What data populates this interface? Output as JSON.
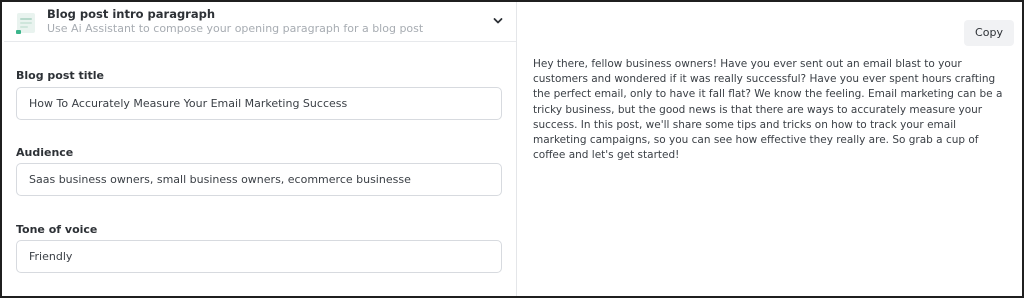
{
  "template": {
    "title": "Blog post intro paragraph",
    "subtitle": "Use Ai Assistant to compose your opening paragraph for a blog post",
    "icon": "document-template-icon",
    "toggle_icon": "chevron-down-icon"
  },
  "form": {
    "blog_title": {
      "label": "Blog post title",
      "value": "How To Accurately Measure Your Email Marketing Success"
    },
    "audience": {
      "label": "Audience",
      "value": "Saas business owners, small business owners, ecommerce businesse"
    },
    "tone": {
      "label": "Tone of voice",
      "value": "Friendly"
    }
  },
  "output": {
    "copy_label": "Copy",
    "text": "Hey there, fellow business owners! Have you ever sent out an email blast to your customers and wondered if it was really successful? Have you ever spent hours crafting the perfect email, only to have it fall flat? We know the feeling. Email marketing can be a tricky business, but the good news is that there are ways to accurately measure your success. In this post, we'll share some tips and tricks on how to track your email marketing campaigns, so you can see how effective they really are. So grab a cup of coffee and let's get started!"
  },
  "colors": {
    "border": "#1f1f1f",
    "accent": "#3bb58b",
    "muted_text": "#a7acb2",
    "button_bg": "#f1f2f4"
  }
}
